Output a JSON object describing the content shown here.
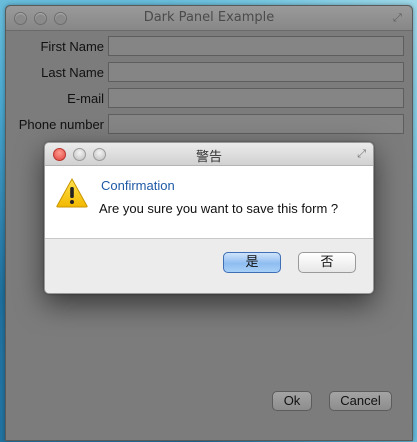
{
  "window": {
    "title": "Dark Panel Example"
  },
  "form": {
    "fields": [
      {
        "label": "First Name",
        "value": ""
      },
      {
        "label": "Last Name",
        "value": ""
      },
      {
        "label": "E-mail",
        "value": ""
      },
      {
        "label": "Phone number",
        "value": ""
      }
    ],
    "ok_label": "Ok",
    "cancel_label": "Cancel"
  },
  "dialog": {
    "title": "警告",
    "heading": "Confirmation",
    "message": "Are you sure you want to save this form ?",
    "yes_label": "是",
    "no_label": "否",
    "icon": "warning-icon"
  },
  "colors": {
    "panel_background": "#7c7c7c",
    "dialog_heading": "#1f5aa6",
    "default_button": "#8fbdf1"
  }
}
